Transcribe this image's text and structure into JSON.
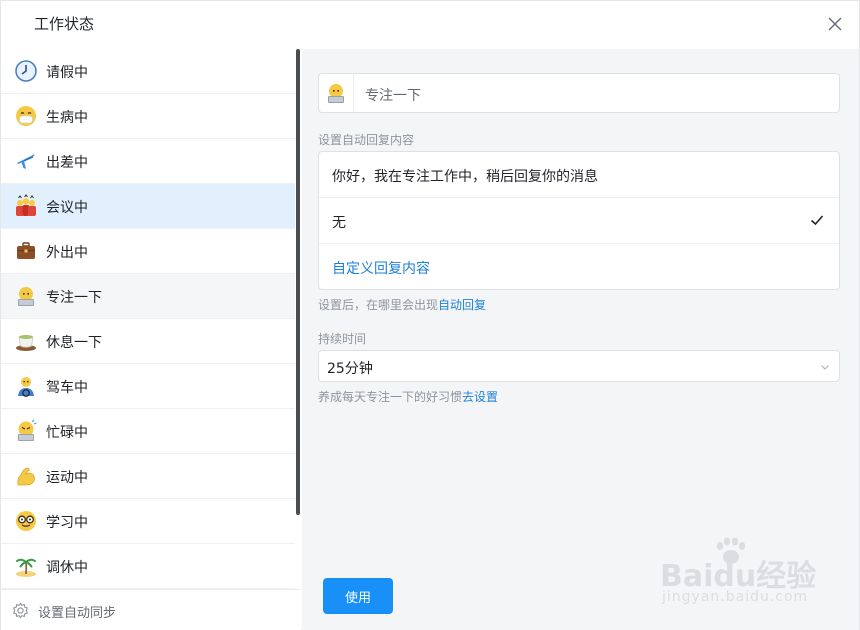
{
  "window": {
    "title": "工作状态"
  },
  "statuses": [
    {
      "label": "请假中",
      "icon": "clock-icon",
      "state": "normal"
    },
    {
      "label": "生病中",
      "icon": "sick-mask-face-icon",
      "state": "normal"
    },
    {
      "label": "出差中",
      "icon": "airplane-icon",
      "state": "normal"
    },
    {
      "label": "会议中",
      "icon": "meeting-people-icon",
      "state": "selected"
    },
    {
      "label": "外出中",
      "icon": "briefcase-icon",
      "state": "normal"
    },
    {
      "label": "专注一下",
      "icon": "focus-laptop-face-icon",
      "state": "hover"
    },
    {
      "label": "休息一下",
      "icon": "tea-cup-icon",
      "state": "normal"
    },
    {
      "label": "驾车中",
      "icon": "driving-person-icon",
      "state": "normal"
    },
    {
      "label": "忙碌中",
      "icon": "busy-face-icon",
      "state": "normal"
    },
    {
      "label": "运动中",
      "icon": "flexed-arm-icon",
      "state": "normal"
    },
    {
      "label": "学习中",
      "icon": "nerd-glasses-face-icon",
      "state": "normal"
    },
    {
      "label": "调休中",
      "icon": "palm-island-icon",
      "state": "normal"
    }
  ],
  "left_footer": {
    "label": "设置自动同步",
    "icon": "gear-icon"
  },
  "detail": {
    "name": "专注一下",
    "reply_section_label": "设置自动回复内容",
    "reply_options": [
      {
        "text": "你好，我在专注工作中，稍后回复你的消息",
        "checked": false
      },
      {
        "text": "无",
        "checked": true
      }
    ],
    "custom_reply_link": "自定义回复内容",
    "reply_hint_prefix": "设置后，在哪里会出现",
    "reply_hint_link": "自动回复",
    "duration_label": "持续时间",
    "duration_value": "25分钟",
    "habit_hint_prefix": "养成每天专注一下的好习惯",
    "habit_hint_link": "去设置",
    "use_button": "使用"
  },
  "watermark": {
    "main": "Baidu经验",
    "sub": "jingyan.baidu.com"
  },
  "colors": {
    "accent": "#1890f7",
    "link": "#1e7fd9",
    "selected_row": "#e1f0fc",
    "panel_bg": "#f4f5f7"
  }
}
